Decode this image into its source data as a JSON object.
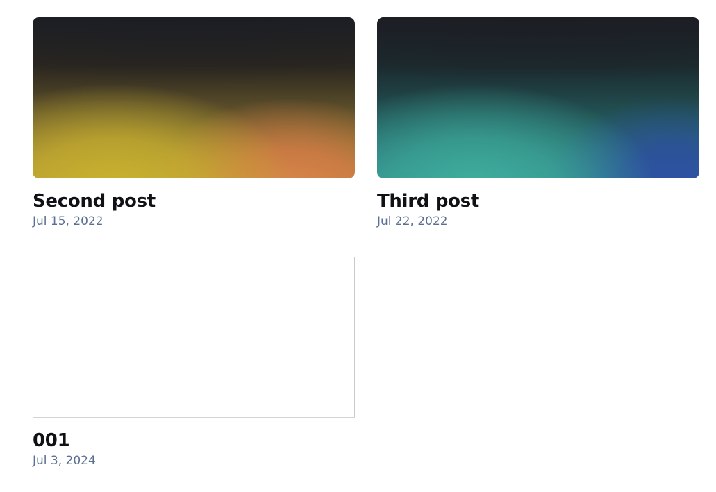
{
  "posts": [
    {
      "title": "Second post",
      "date": "Jul 15, 2022",
      "thumbnail": "yellow-orange-gradient"
    },
    {
      "title": "Third post",
      "date": "Jul 22, 2022",
      "thumbnail": "teal-blue-gradient"
    },
    {
      "title": "001",
      "date": "Jul 3, 2024",
      "thumbnail": "blank"
    }
  ]
}
